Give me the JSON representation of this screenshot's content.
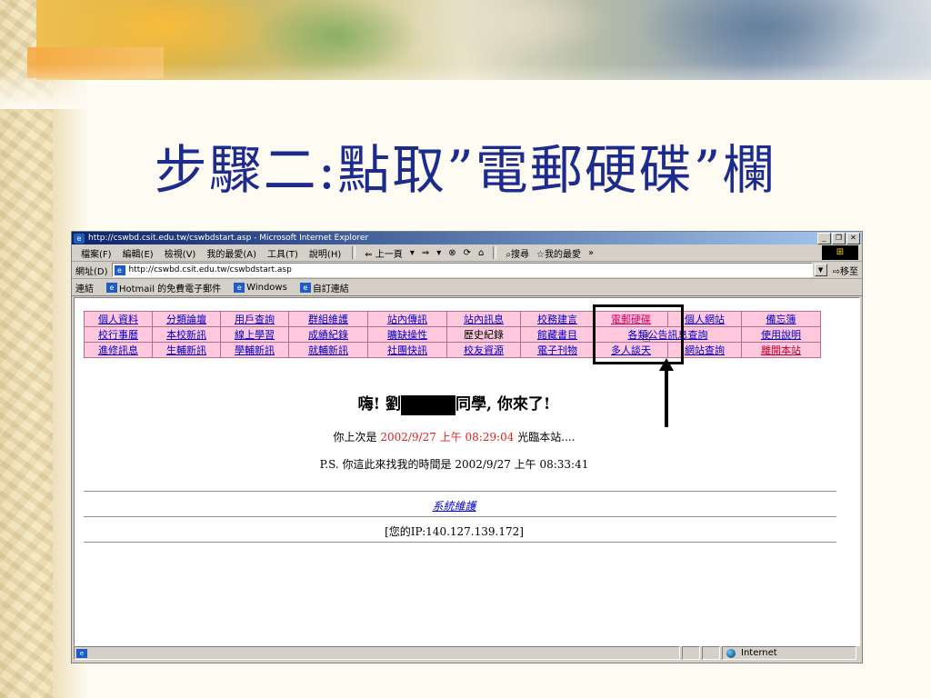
{
  "slide": {
    "title": "步驟二:點取”電郵硬碟”欄"
  },
  "browser": {
    "window_title": "http://cswbd.csit.edu.tw/cswbdstart.asp - Microsoft Internet Explorer",
    "menu": [
      "檔案(F)",
      "編輯(E)",
      "檢視(V)",
      "我的最愛(A)",
      "工具(T)",
      "說明(H)"
    ],
    "toolbar": {
      "back": "⇐ 上一頁",
      "forward": "⇒",
      "search": "搜尋",
      "favorites": "我的最愛",
      "more": "»"
    },
    "address_label": "網址(D)",
    "address_value": "http://cswbd.csit.edu.tw/cswbdstart.asp",
    "go_label": "移至",
    "links_label": "連結",
    "links": [
      "Hotmail 的免費電子郵件",
      "Windows",
      "自訂連結"
    ],
    "status_zone": "Internet"
  },
  "page": {
    "nav_rows": [
      [
        "個人資料",
        "分類論壇",
        "用戶查詢",
        "群組維護",
        "站內傳訊",
        "站內訊息",
        "校務建言",
        "電郵硬碟",
        "個人網站",
        "備忘簿"
      ],
      [
        "校行事曆",
        "本校新訊",
        "線上學習",
        "成績紀錄",
        "曠缺操性",
        "歷史紀錄",
        "館藏書目",
        "各類公告訊息查詢",
        "使用說明"
      ],
      [
        "進修訊息",
        "生輔新訊",
        "學輔新訊",
        "就輔新訊",
        "社團快訊",
        "校友資源",
        "電子刊物",
        "多人談天",
        "網站查詢",
        "離開本站"
      ]
    ],
    "greeting_prefix": "嗨! 劉",
    "greeting_suffix": "同學, 你來了!",
    "last_visit_prefix": "你上次是 ",
    "last_visit_time": "2002/9/27 上午 08:29:04",
    "last_visit_suffix": " 光臨本站....",
    "ps_line": "P.S. 你這此來找我的時間是 2002/9/27  上午 08:33:41",
    "sys_maint": "系統維護",
    "ip_line": "[您的IP:140.127.139.172]"
  },
  "colors": {
    "title": "#1c2b8c",
    "nav_cell": "#ffc8dc",
    "highlight_red": "#e02020"
  }
}
